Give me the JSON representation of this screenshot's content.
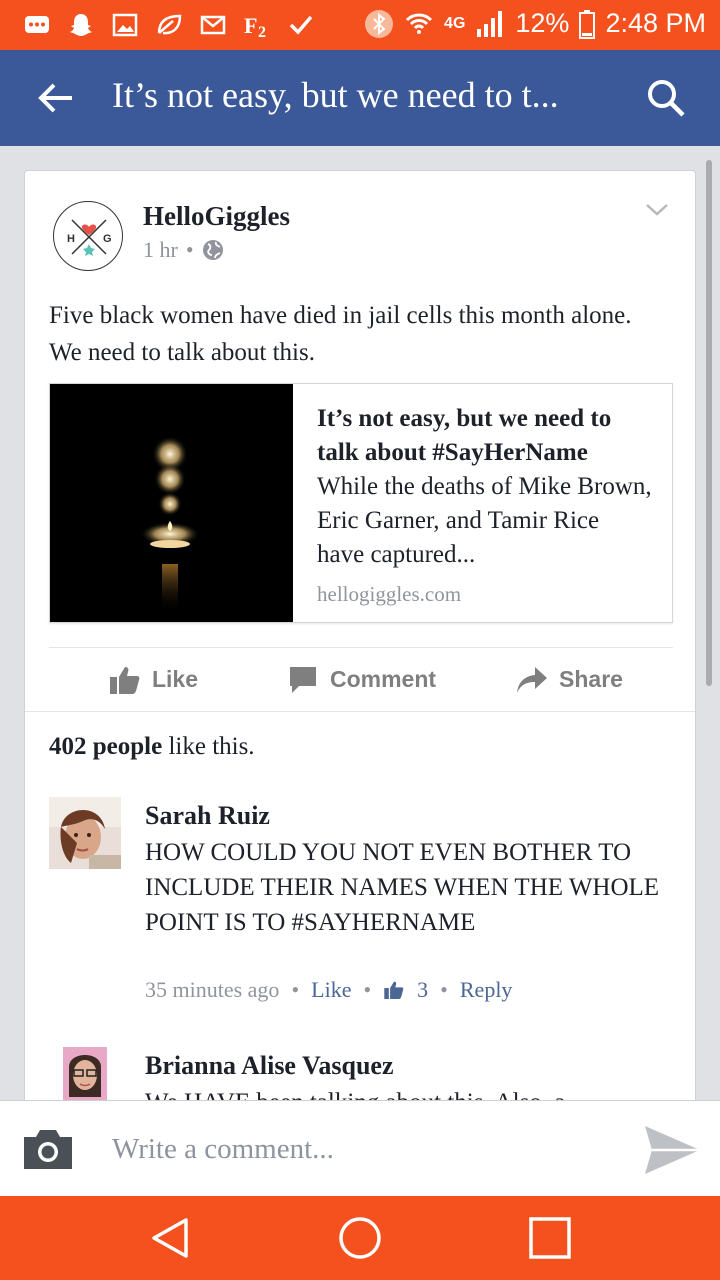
{
  "status_bar": {
    "network": "4G",
    "battery": "12%",
    "time": "2:48 PM"
  },
  "app_bar": {
    "title": "It’s not easy, but we need to t..."
  },
  "post": {
    "author": "HelloGiggles",
    "avatar_letters": {
      "left": "H",
      "right": "G"
    },
    "time": "1 hr",
    "separator": "•",
    "text": "Five black women have died in jail cells this month alone. We need to talk about this.",
    "link": {
      "title": "It’s not easy, but we need to talk about #SayHerName",
      "description": "While the deaths of Mike Brown, Eric Garner, and Tamir Rice have captured...",
      "domain": "hellogiggles.com"
    },
    "actions": {
      "like": "Like",
      "comment": "Comment",
      "share": "Share"
    },
    "likes": {
      "count": "402 people",
      "suffix": " like this."
    }
  },
  "comments": [
    {
      "name": "Sarah Ruiz",
      "text": "HOW COULD YOU NOT EVEN BOTHER TO INCLUDE THEIR NAMES WHEN THE WHOLE POINT IS TO #SAYHERNAME",
      "time": "35 minutes ago",
      "like_label": "Like",
      "like_count": "3",
      "reply_label": "Reply",
      "dot": "•"
    },
    {
      "name": "Brianna Alise Vasquez",
      "text": "We HAVE been talking about this. Also, a"
    }
  ],
  "composer": {
    "placeholder": "Write a comment..."
  },
  "colors": {
    "status_bar": "#f4511e",
    "app_bar": "#3b5998",
    "nav_bar": "#f4511e",
    "link_text": "#4b6594"
  }
}
